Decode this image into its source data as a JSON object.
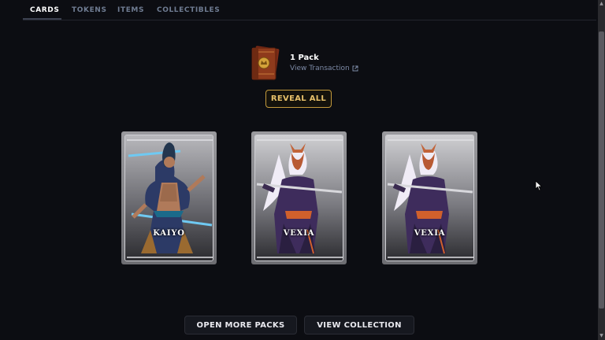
{
  "tabs": [
    {
      "label": "CARDS",
      "active": true
    },
    {
      "label": "TOKENS",
      "active": false
    },
    {
      "label": "ITEMS",
      "active": false
    },
    {
      "label": "COLLECTIBLES",
      "active": false
    }
  ],
  "pack": {
    "title": "1 Pack",
    "view_transaction": "View Transaction",
    "icon": "card-pack-icon"
  },
  "reveal_all_label": "REVEAL ALL",
  "cards": [
    {
      "name": "KAIYO"
    },
    {
      "name": "VEXIA"
    },
    {
      "name": "VEXIA"
    }
  ],
  "actions": {
    "open_more": "OPEN MORE PACKS",
    "view_collection": "VIEW COLLECTION"
  },
  "colors": {
    "background": "#0c0d12",
    "accent_gold": "#e6c06a",
    "link": "#7d8aa6"
  }
}
